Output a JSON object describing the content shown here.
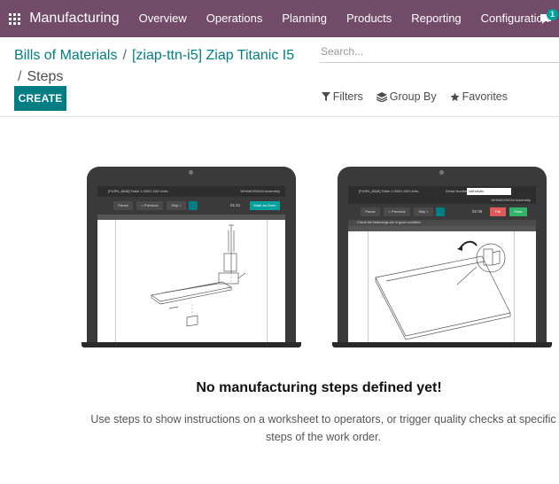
{
  "navbar": {
    "app_name": "Manufacturing",
    "menu": [
      "Overview",
      "Operations",
      "Planning",
      "Products",
      "Reporting",
      "Configuration"
    ],
    "chat_badge": "1",
    "bg_color": "#714b67"
  },
  "breadcrumb": {
    "crumb1": "Bills of Materials",
    "crumb2": "[ziap-ttn-i5] Ziap Titanic I5",
    "current": "Steps",
    "separator": "/"
  },
  "search": {
    "placeholder": "Search..."
  },
  "actions": {
    "create_label": "CREATE",
    "filters_label": "Filters",
    "group_by_label": "Group By",
    "favorites_label": "Favorites"
  },
  "helper": {
    "title": "No manufacturing steps defined yet!",
    "text": "Use steps to show instructions on a worksheet to operators, or trigger quality checks at specific steps of the work order."
  },
  "illustrations": {
    "left": {
      "header": "[FURN_8848] Table 1.000/1.000 Units",
      "header_right": "WH/MO/00016 Assembly",
      "btn_pause": "Pause",
      "btn_previous": "< Previous",
      "btn_skip": "Skip >",
      "timer": "01:41",
      "btn_validate": "Mark as Done"
    },
    "right": {
      "header": "[FURN_8848] Table 1.000/1.000 Units",
      "serial_label": "Serial Number",
      "serial_value": "sdfhdsdfs",
      "header_right": "WH/MO/00016 Assembly",
      "btn_pause": "Pause",
      "btn_previous": "< Previous",
      "btn_skip": "Skip >",
      "timer": "02:36",
      "btn_fail": "Fail",
      "btn_pass": "Pass",
      "instruction": "Check the fastenings are in good condition"
    }
  },
  "colors": {
    "accent": "#017e84",
    "fail": "#e05a5a",
    "pass": "#2fb46a"
  }
}
